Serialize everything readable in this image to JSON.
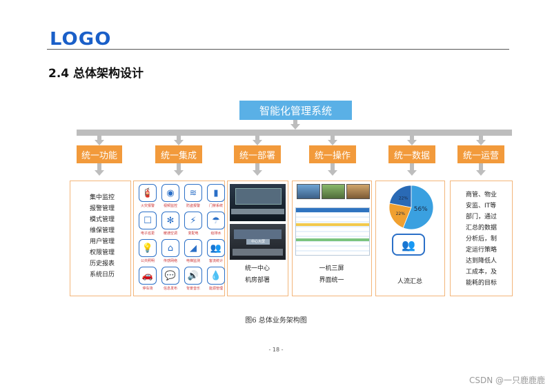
{
  "header": {
    "logo": "LOGO",
    "heading": "2.4 总体架构设计"
  },
  "diagram": {
    "top": "智能化管理系统",
    "columns": [
      {
        "label": "统一功能",
        "items": [
          "集中监控",
          "报警管理",
          "模式管理",
          "维保管理",
          "用户管理",
          "权限管理",
          "历史报表",
          "系统日历"
        ]
      },
      {
        "label": "统一集成",
        "icons": [
          {
            "name": "fire-extinguisher-icon",
            "label": "火灾报警",
            "glyph": "🧯"
          },
          {
            "name": "camera-icon",
            "label": "视频监控",
            "glyph": "◉"
          },
          {
            "name": "alarm-icon",
            "label": "防盗报警",
            "glyph": "≋"
          },
          {
            "name": "door-icon",
            "label": "门禁系统",
            "glyph": "▮"
          },
          {
            "name": "patrol-icon",
            "label": "电子巡更",
            "glyph": "☐"
          },
          {
            "name": "ac-icon",
            "label": "暖通空调",
            "glyph": "✻"
          },
          {
            "name": "power-icon",
            "label": "变配电",
            "glyph": "⚡"
          },
          {
            "name": "water-icon",
            "label": "给排水",
            "glyph": "☂"
          },
          {
            "name": "lighting-icon",
            "label": "公共照明",
            "glyph": "💡"
          },
          {
            "name": "building-icon",
            "label": "传感网络",
            "glyph": "⌂"
          },
          {
            "name": "elevator-icon",
            "label": "电梯监测",
            "glyph": "◢"
          },
          {
            "name": "people-icon",
            "label": "客流统计",
            "glyph": "👥"
          },
          {
            "name": "car-icon",
            "label": "停车场",
            "glyph": "🚗"
          },
          {
            "name": "chat-icon",
            "label": "信息发布",
            "glyph": "💬"
          },
          {
            "name": "music-icon",
            "label": "背景音乐",
            "glyph": "🔊"
          },
          {
            "name": "energy-icon",
            "label": "能源管理",
            "glyph": "💧"
          }
        ]
      },
      {
        "label": "统一部署",
        "lines": [
          "统一中心",
          "机房部署"
        ],
        "photo_tag": "中心大屏"
      },
      {
        "label": "统一操作",
        "lines": [
          "一机三屏",
          "界面统一"
        ]
      },
      {
        "label": "统一数据",
        "pie": {
          "values": [
            56,
            22,
            22
          ],
          "labels": [
            "56%",
            "22%",
            "22%"
          ],
          "colors": [
            "#3aa0e0",
            "#f0a030",
            "#2a6ab5"
          ]
        },
        "lines": [
          "人流汇总"
        ]
      },
      {
        "label": "统一运营",
        "items": [
          "商管、物业",
          "安监、IT等",
          "部门，通过",
          "汇总的数据",
          "分析后，制",
          "定运行策略",
          "达到降低人",
          "工成本，及",
          "能耗的目标"
        ]
      }
    ]
  },
  "figure_caption": "图6 总体业务架构图",
  "page_number": "- 18 -",
  "watermark": "CSDN @一只鹿鹿鹿"
}
